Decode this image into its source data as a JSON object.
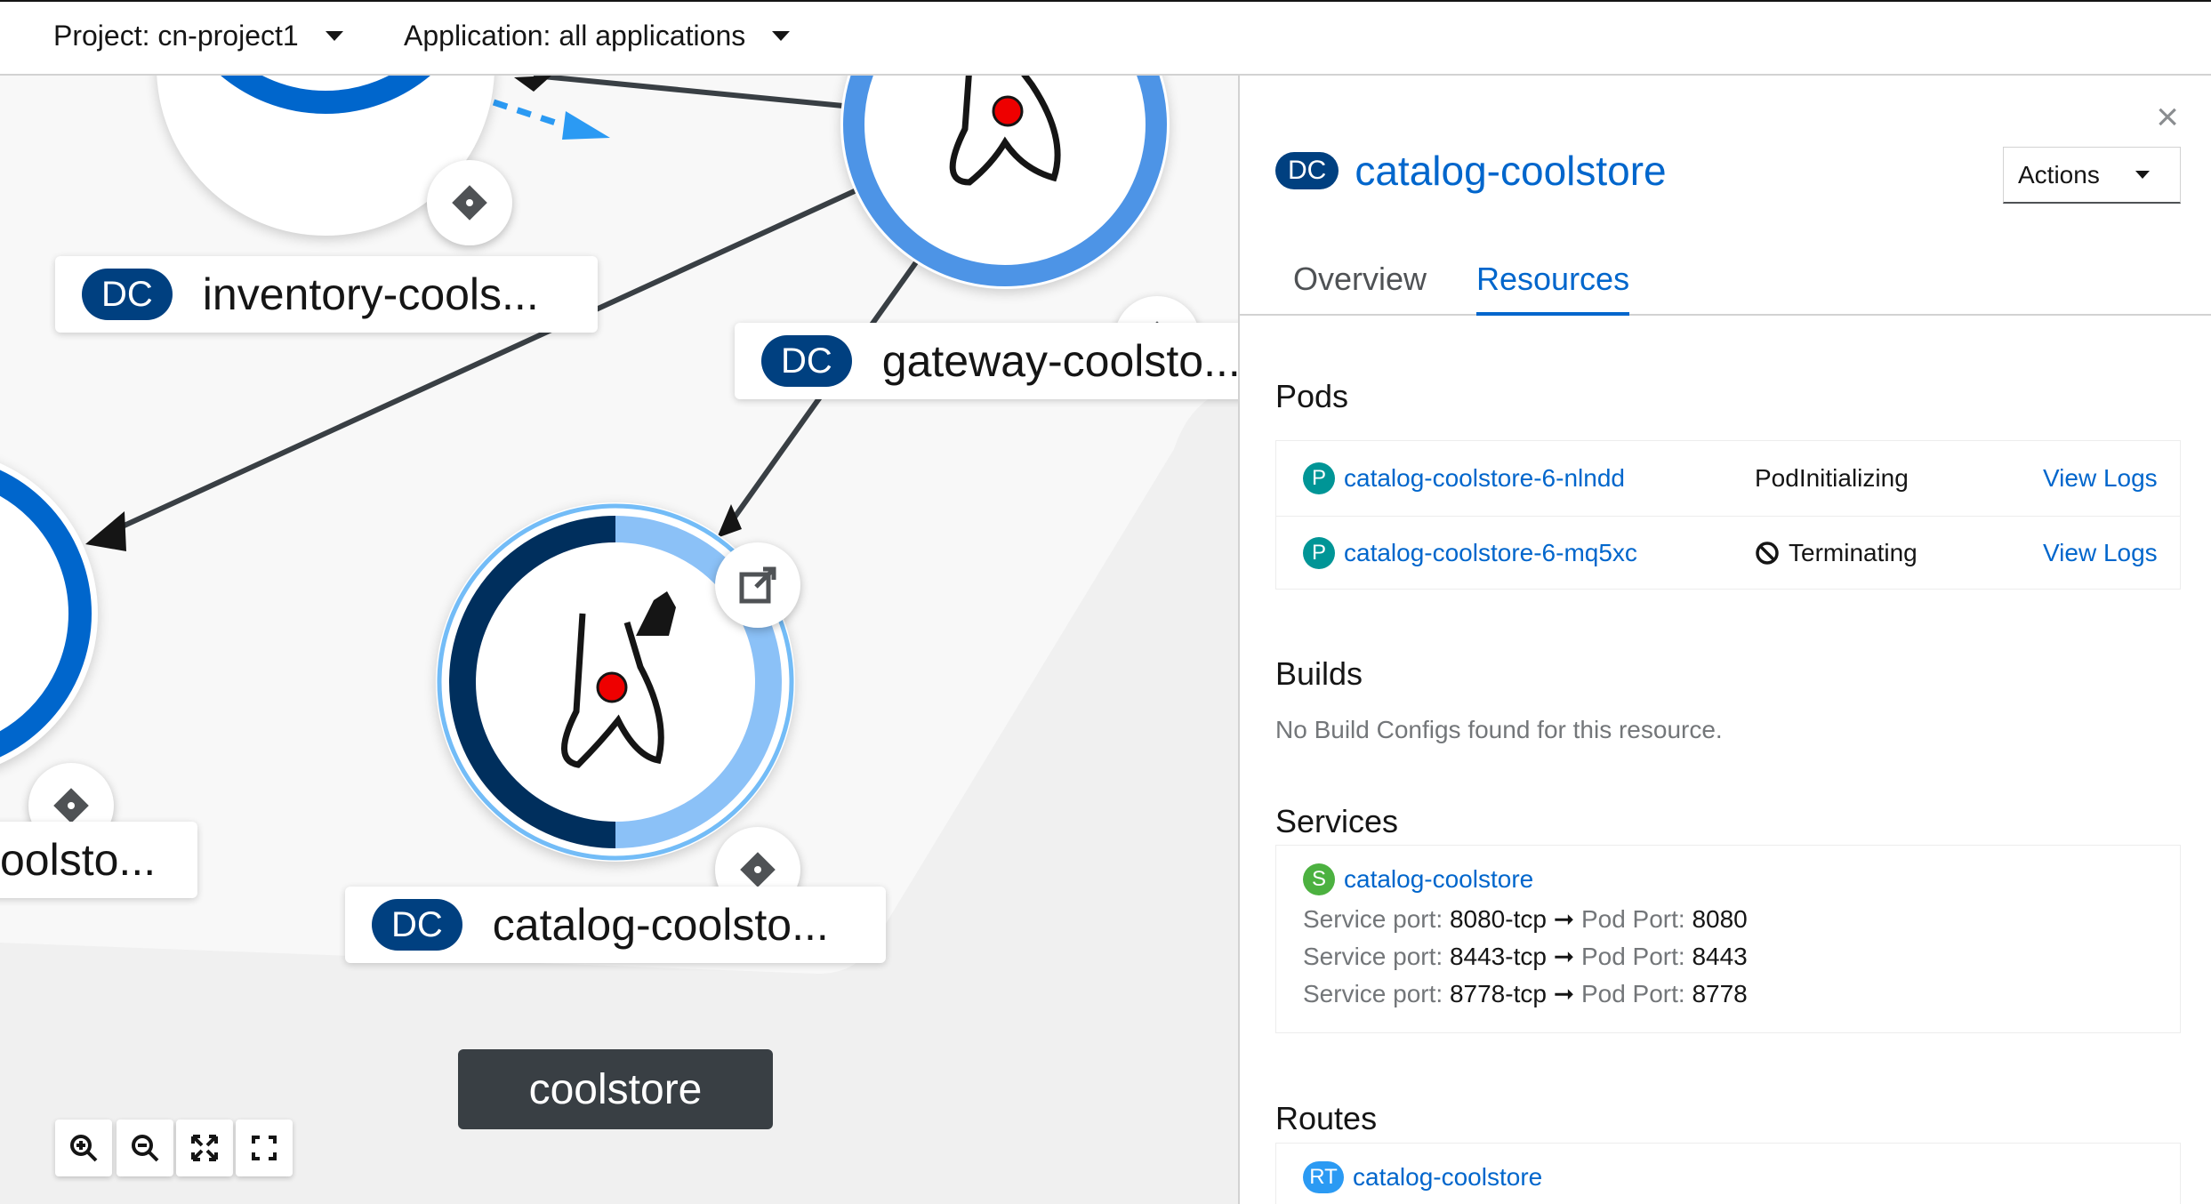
{
  "topbar": {
    "project_label": "Project: cn-project1",
    "application_label": "Application: all applications"
  },
  "topology": {
    "nodes": [
      {
        "kind": "DC",
        "label": "inventory-cools..."
      },
      {
        "kind": "DC",
        "label": "gateway-coolsto..."
      },
      {
        "kind": "DC",
        "label": "catalog-coolsto..."
      },
      {
        "kind": "DC",
        "label": "oolsto..."
      }
    ],
    "group_label": "coolstore",
    "colors": {
      "dark_blue": "#004080",
      "mid_blue": "#0066cc",
      "light_blue": "#73bcf7",
      "navy": "#002f5d",
      "pale_blue": "#8bc1f7"
    }
  },
  "panel": {
    "kind": "DC",
    "title": "catalog-coolstore",
    "actions_label": "Actions",
    "close_icon": "×",
    "tabs": [
      {
        "label": "Overview"
      },
      {
        "label": "Resources"
      }
    ],
    "pods_title": "Pods",
    "pods": [
      {
        "icon": "P",
        "name": "catalog-coolstore-6-nlndd",
        "status": "PodInitializing",
        "action": "View Logs"
      },
      {
        "icon": "P",
        "name": "catalog-coolstore-6-mq5xc",
        "status": "Terminating",
        "action": "View Logs"
      }
    ],
    "builds_title": "Builds",
    "builds_empty": "No Build Configs found for this resource.",
    "services_title": "Services",
    "service": {
      "icon": "S",
      "name": "catalog-coolstore",
      "ports": [
        {
          "service_label": "Service port:",
          "service_port": "8080-tcp",
          "pod_label": "Pod Port:",
          "pod_port": "8080"
        },
        {
          "service_label": "Service port:",
          "service_port": "8443-tcp",
          "pod_label": "Pod Port:",
          "pod_port": "8443"
        },
        {
          "service_label": "Service port:",
          "service_port": "8778-tcp",
          "pod_label": "Pod Port:",
          "pod_port": "8778"
        }
      ]
    },
    "routes_title": "Routes",
    "route": {
      "icon": "RT",
      "name": "catalog-coolstore"
    },
    "colors": {
      "pod_icon": "#009596",
      "svc_icon": "#4cb140",
      "rt_icon": "#2b9af3",
      "link": "#0066cc"
    }
  }
}
